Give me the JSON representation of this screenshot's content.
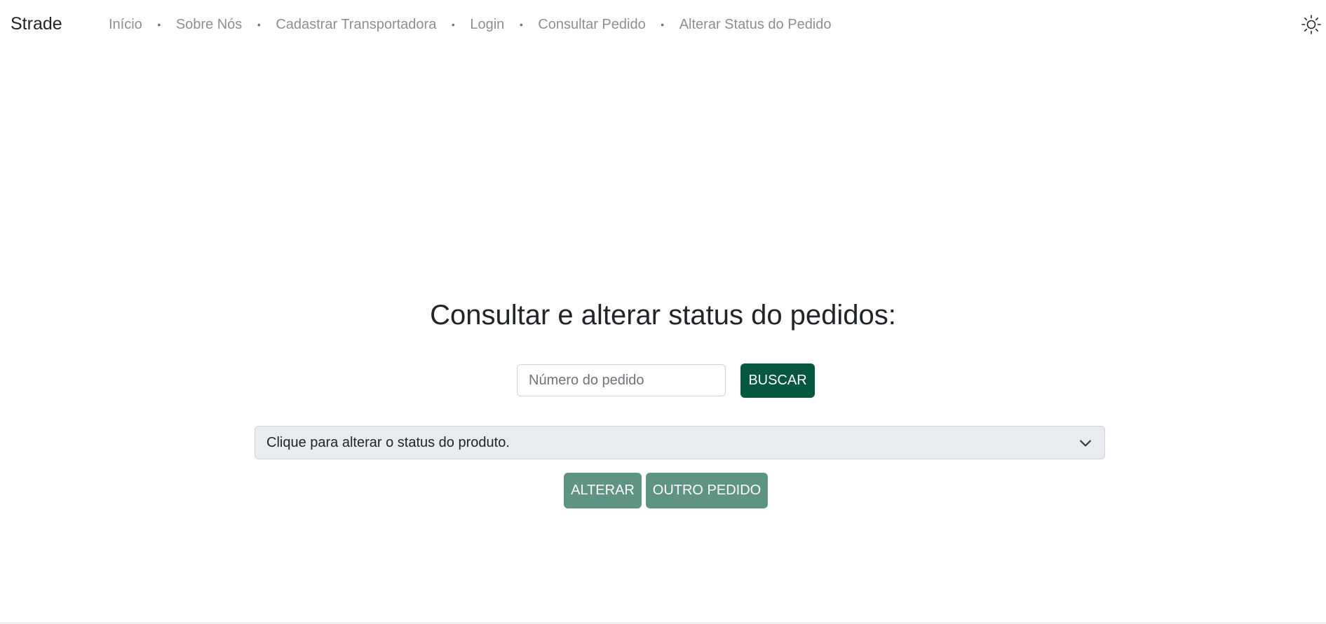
{
  "nav": {
    "brand": "Strade",
    "links": [
      "Início",
      "Sobre Nós",
      "Cadastrar Transportadora",
      "Login",
      "Consultar Pedido",
      "Alterar Status do Pedido"
    ],
    "theme_icon": "sun-icon"
  },
  "main": {
    "title": "Consultar e alterar status do pedidos:",
    "search_placeholder": "Número do pedido",
    "search_value": "",
    "search_button": "BUSCAR",
    "status_select": "Clique para alterar o status do produto.",
    "alter_button": "ALTERAR",
    "other_button": "OUTRO PEDIDO"
  },
  "colors": {
    "primary": "#06573f",
    "primary_disabled": "#5f9484",
    "nav_link": "#8a8f94",
    "select_bg": "#e9ecef"
  }
}
